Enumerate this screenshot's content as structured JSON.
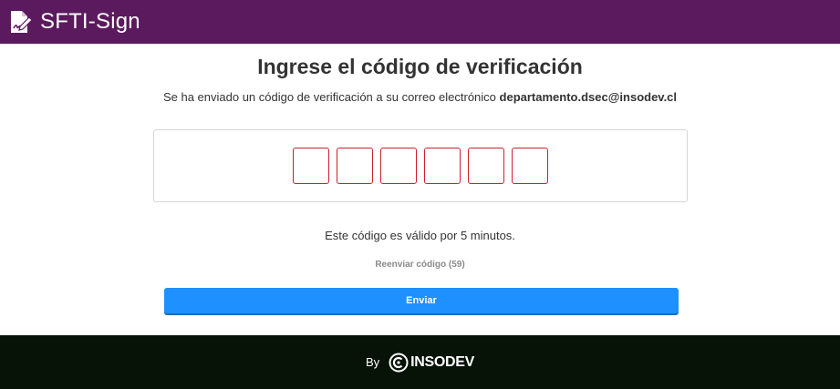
{
  "header": {
    "app_title": "SFTI-Sign",
    "logo_icon": "signed-document-icon",
    "background_color": "#5b1a5e"
  },
  "main": {
    "title": "Ingrese el código de verificación",
    "subtitle_prefix": "Se ha enviado un código de verificación a su correo electrónico",
    "email": "departamento.dsec@insodev.cl",
    "code_inputs": [
      "",
      "",
      "",
      "",
      "",
      ""
    ],
    "code_input_border_color": "#cc1f2d",
    "validity_text": "Este código es válido por 5 minutos.",
    "resend_label": "Reenviar código (59)",
    "submit_label": "Enviar",
    "submit_color": "#1e90ff"
  },
  "footer": {
    "by_label": "By",
    "brand_icon": "insodev-logo-icon",
    "brand_name": "INSODEV",
    "background_color": "#061306"
  }
}
